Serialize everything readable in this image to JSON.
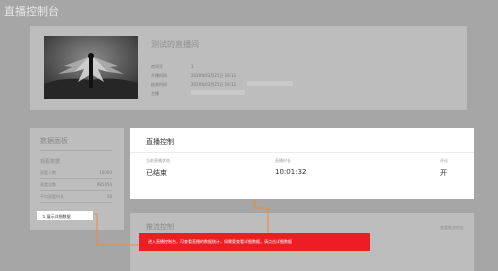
{
  "page": {
    "title": "直播控制台"
  },
  "room": {
    "name": "测试的直播间",
    "fields": [
      {
        "label": "房间号",
        "value": "3"
      },
      {
        "label": "开播时间",
        "value": "2020年03月25日 19:11"
      },
      {
        "label": "结束时间",
        "value": "2020年03月25日 19:11"
      },
      {
        "label": "主播",
        "value": ""
      }
    ]
  },
  "data_panel": {
    "title": "数据面板",
    "section": "观看数据",
    "rows": [
      {
        "label": "观看人数",
        "value": "10000"
      },
      {
        "label": "观看次数",
        "value": "985454"
      },
      {
        "label": "平均观看时长",
        "value": "50"
      }
    ],
    "detail_button": "展示详细数据"
  },
  "live_control": {
    "title": "直播控制",
    "columns": [
      {
        "label": "当前直播状态",
        "value": "已结束"
      },
      {
        "label": "直播时长",
        "value": "10:01:32"
      },
      {
        "label": "评论",
        "value": "开"
      }
    ]
  },
  "push_control": {
    "title": "推流控制",
    "link": "查看推流地址"
  },
  "callout": {
    "text": "进入直播控制台，可查看直播的数据统计，如需要查看详细数据，请点击详细数据"
  },
  "colors": {
    "overlay": "#a6a6a6",
    "callout_bg": "#ee1d23",
    "connector": "#f08a3c"
  }
}
